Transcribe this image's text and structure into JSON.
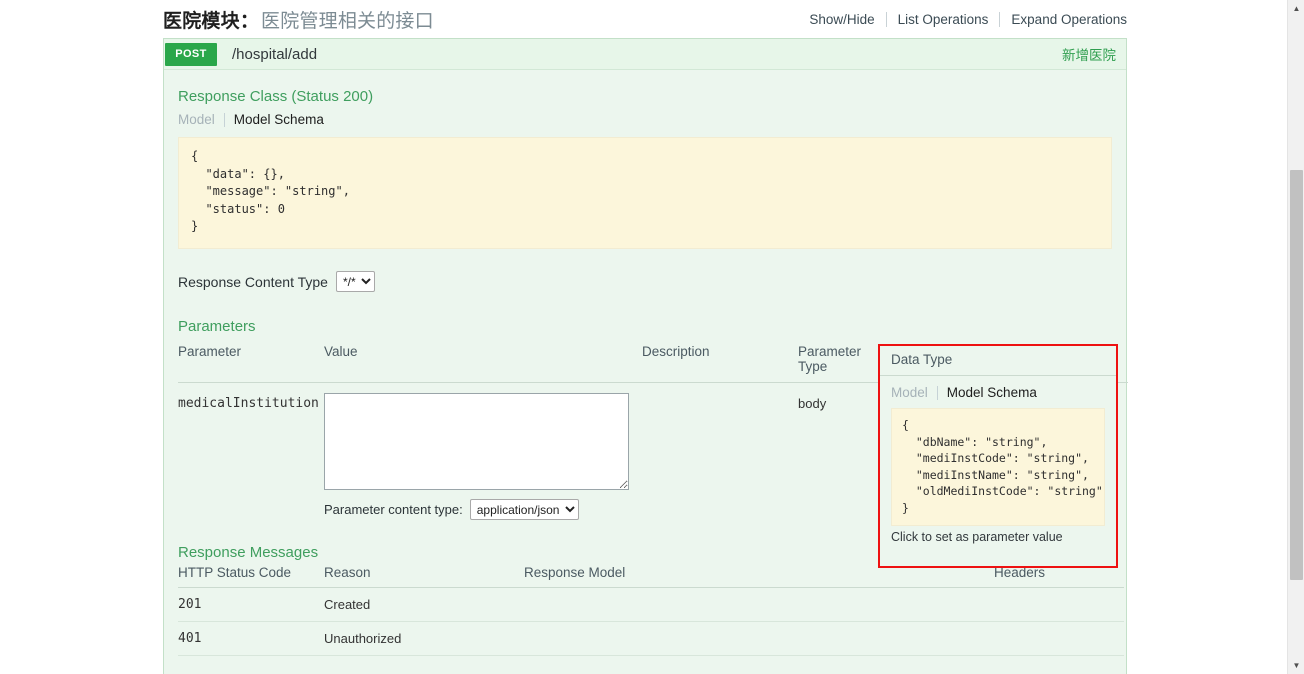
{
  "resource": {
    "title": "医院模块",
    "separator": "：",
    "description": "医院管理相关的接口",
    "controls": [
      {
        "label": "Show/Hide"
      },
      {
        "label": "List Operations"
      },
      {
        "label": "Expand Operations"
      }
    ]
  },
  "operation": {
    "method": "POST",
    "path": "/hospital/add",
    "summary": "新增医院",
    "response_class": {
      "heading": "Response Class (Status 200)",
      "tabs": {
        "inactive": "Model",
        "active": "Model Schema"
      },
      "schema": "{\n  \"data\": {},\n  \"message\": \"string\",\n  \"status\": 0\n}"
    },
    "response_content_type": {
      "label": "Response Content Type",
      "selected": "*/*",
      "options": [
        "*/*"
      ]
    },
    "parameters": {
      "heading": "Parameters",
      "columns": [
        "Parameter",
        "Value",
        "Description",
        "Parameter Type",
        "Data Type"
      ],
      "rows": [
        {
          "name": "medicalInstitution",
          "value": "",
          "description": "",
          "parameter_type": "body",
          "content_type_label": "Parameter content type:",
          "content_type_selected": "application/json",
          "content_type_options": [
            "application/json"
          ]
        }
      ],
      "data_type_panel": {
        "header": "Data Type",
        "tabs": {
          "inactive": "Model",
          "active": "Model Schema"
        },
        "schema": "{\n  \"dbName\": \"string\",\n  \"mediInstCode\": \"string\",\n  \"mediInstName\": \"string\",\n  \"oldMediInstCode\": \"string\"\n}",
        "hint": "Click to set as parameter value",
        "highlight_color": "#ee1111"
      }
    },
    "response_messages": {
      "heading": "Response Messages",
      "columns": [
        "HTTP Status Code",
        "Reason",
        "Response Model",
        "Headers"
      ],
      "rows": [
        {
          "code": "201",
          "reason": "Created",
          "model": "",
          "headers": ""
        },
        {
          "code": "401",
          "reason": "Unauthorized",
          "model": "",
          "headers": ""
        }
      ]
    }
  },
  "scrollbar": {
    "up_arrow": "▲",
    "down_arrow": "▼"
  },
  "colors": {
    "method_post": "#2aa74a",
    "section_heading": "#3f9e5e",
    "panel_bg": "#ecf6ee",
    "code_bg": "#fcf6db"
  }
}
